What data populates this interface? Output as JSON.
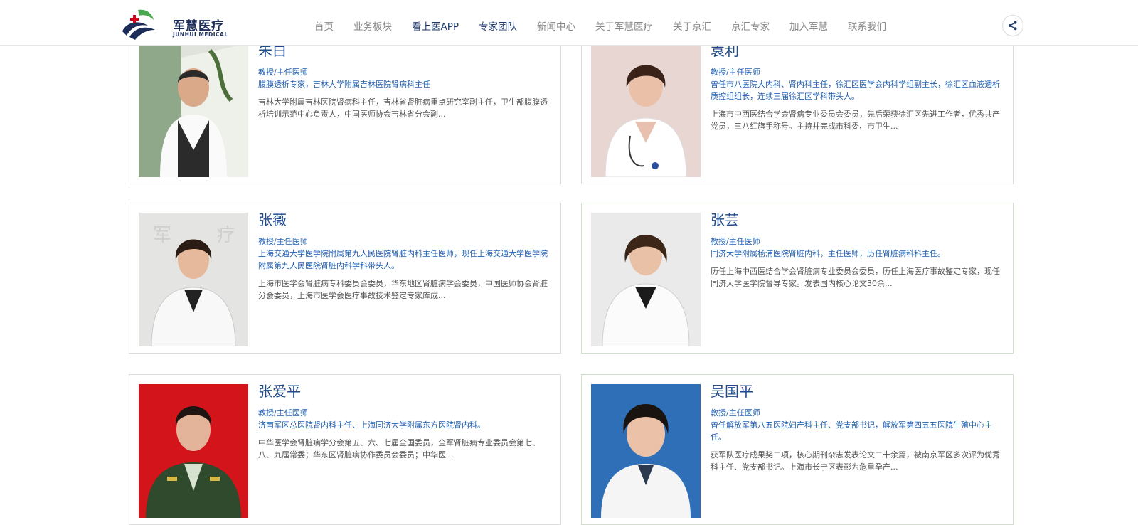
{
  "header": {
    "logo_title": "军慧医疗",
    "logo_subtitle": "JUNHUI MEDICAL",
    "nav": [
      {
        "label": "首页",
        "active": false
      },
      {
        "label": "业务板块",
        "active": false
      },
      {
        "label": "看上医APP",
        "active": true
      },
      {
        "label": "专家团队",
        "active": true
      },
      {
        "label": "新闻中心",
        "active": false
      },
      {
        "label": "关于军慧医疗",
        "active": false
      },
      {
        "label": "关于京汇",
        "active": false
      },
      {
        "label": "京汇专家",
        "active": false
      },
      {
        "label": "加入军慧",
        "active": false
      },
      {
        "label": "联系我们",
        "active": false
      }
    ],
    "share_icon": "share-icon"
  },
  "experts": [
    {
      "name": "朱白",
      "title": "教授/主任医师",
      "specialty": "腹膜透析专家，吉林大学附属吉林医院肾病科主任",
      "description": "吉林大学附属吉林医院肾病科主任，吉林省肾脏病重点研究室副主任，卫生部腹膜透析培训示范中心负责人，中国医师协会吉林省分会副..."
    },
    {
      "name": "袁利",
      "title": "教授/主任医师",
      "specialty": "曾任市八医院大内科、肾内科主任，徐汇区医学会内科学组副主长，徐汇区血液透析质控组组长，连续三届徐汇区学科带头人。",
      "description": "上海市中西医结合学会肾病专业委员会委员，先后荣获徐汇区先进工作者，优秀共产党员，三八红旗手称号。主持并完成市科委、市卫生..."
    },
    {
      "name": "张薇",
      "title": "教授/主任医师",
      "specialty": "上海交通大学医学院附属第九人民医院肾脏内科主任医师，现任上海交通大学医学院附属第九人民医院肾脏内科学科带头人。",
      "description": "上海市医学会肾脏病专科委员会委员，华东地区肾脏病学会委员，中国医师协会肾脏分会委员，上海市医学会医疗事故技术鉴定专家库成..."
    },
    {
      "name": "张芸",
      "title": "教授/主任医师",
      "specialty": "同济大学附属杨浦医院肾脏内科，主任医师，历任肾脏病科科主任。",
      "description": "历任上海中西医结合学会肾脏病专业委员会委员，历任上海医疗事故鉴定专家，现任同济大学医学院督导专家。发表国内核心论文30余..."
    },
    {
      "name": "张爱平",
      "title": "教授/主任医师",
      "specialty": "济南军区总医院肾内科主任、上海同济大学附属东方医院肾内科。",
      "description": "中华医学会肾脏病学分会第五、六、七届全国委员，全军肾脏病专业委员会第七、八、九届常委；华东区肾脏病协作委员会委员；中华医..."
    },
    {
      "name": "吴国平",
      "title": "教授/主任医师",
      "specialty": "曾任解放军第八五医院妇产科主任、党支部书记，解放军第四五五医院生殖中心主任。",
      "description": "获军队医疗成果奖二项，核心期刊杂志发表论文二十余篇，被南京军区多次评为优秀科主任、党支部书记。上海市长宁区表彰为危重孕产..."
    }
  ],
  "colors": {
    "nav_active": "#1e3a6e",
    "name": "#1e4a8a",
    "link_blue": "#1f5fb0",
    "logo_red": "#d7001b"
  }
}
